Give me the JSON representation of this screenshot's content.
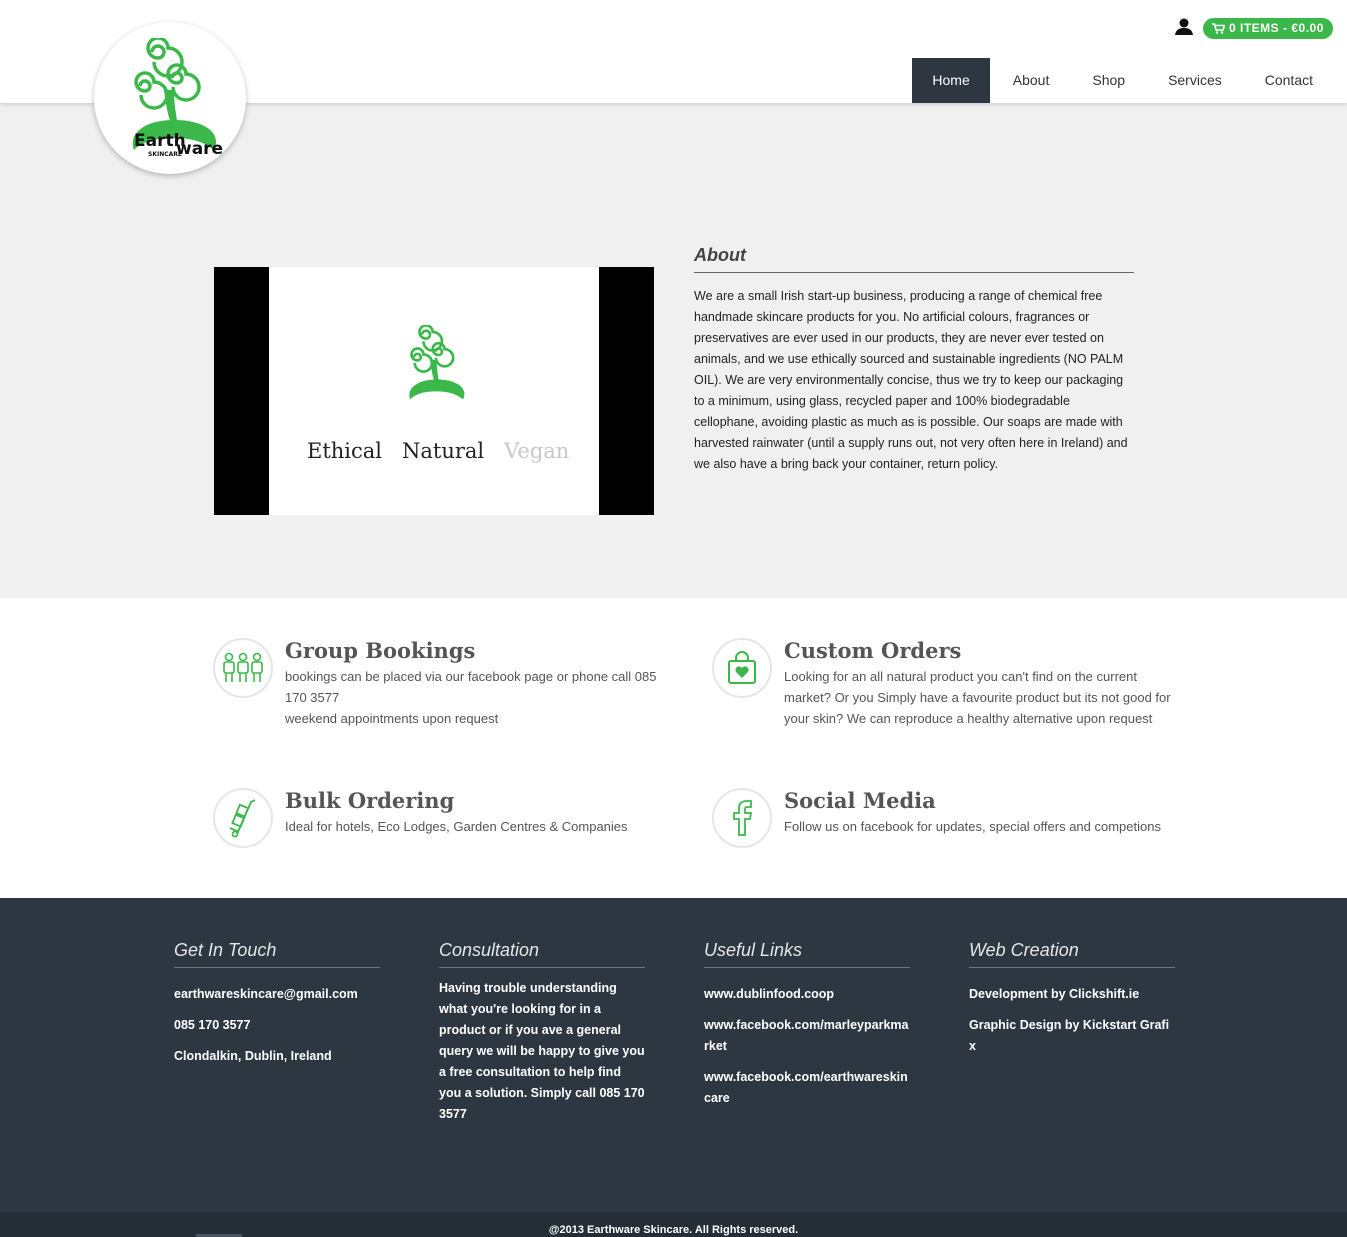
{
  "brand": {
    "name": "EarthWare Skincare",
    "logo_word1": "Earth",
    "logo_word2": "ware",
    "logo_sub": "SKINCARE",
    "accent": "#3cb84a"
  },
  "header": {
    "user_icon": "user-icon",
    "cart": {
      "icon": "cart-icon",
      "label": "0 ITEMS - €0.00"
    },
    "nav": [
      {
        "label": "Home",
        "active": true
      },
      {
        "label": "About",
        "active": false
      },
      {
        "label": "Shop",
        "active": false
      },
      {
        "label": "Services",
        "active": false
      },
      {
        "label": "Contact",
        "active": false
      }
    ]
  },
  "about": {
    "video": {
      "words": [
        "Ethical",
        "Natural",
        "Vegan"
      ]
    },
    "title": "About",
    "text": "We are a small Irish start-up business, producing a range of chemical free handmade skincare products for you. No artificial colours, fragrances or preservatives are ever used in our products, they are never ever tested on animals, and we use ethically sourced and sustainable ingredients (NO PALM OIL). We are very environmentally concise, thus we try to keep our packaging to a minimum, using glass, recycled paper and 100% biodegradable cellophane, avoiding plastic as much as is possible. Our soaps are made with harvested rainwater (until a supply runs out, not very often here in Ireland) and we also have a bring back your container, return policy."
  },
  "services": [
    {
      "icon": "group-icon",
      "title": "Group Bookings",
      "lines": [
        "bookings can be placed via our facebook page or phone call 085 170 3577",
        "weekend appointments upon request"
      ]
    },
    {
      "icon": "shopping-bag-heart-icon",
      "title": "Custom Orders",
      "lines": [
        "Looking for an all natural product you can't find on the current market? Or you Simply have a favourite product but its not good for your skin? We can reproduce a healthy alternative upon request"
      ]
    },
    {
      "icon": "hand-truck-icon",
      "title": "Bulk Ordering",
      "lines": [
        "Ideal for hotels, Eco Lodges, Garden Centres & Companies"
      ]
    },
    {
      "icon": "facebook-icon",
      "title": "Social Media",
      "lines": [
        "Follow us on facebook for updates, special offers and competions"
      ]
    }
  ],
  "footer": {
    "columns": [
      {
        "title": "Get In Touch",
        "items": [
          "earthwareskincare@gmail.com",
          "085 170 3577",
          "Clondalkin, Dublin, Ireland"
        ]
      },
      {
        "title": "Consultation",
        "text": "Having trouble understanding what you're looking for in a product or if you ave a general query we will be happy to give you a free consultation to help find you a solution. Simply call 085 170 3577"
      },
      {
        "title": "Useful Links",
        "items": [
          "www.dublinfood.coop",
          "www.facebook.com/marleyparkmarket",
          "www.facebook.com/earthwareskincare"
        ]
      },
      {
        "title": "Web Creation",
        "items": [
          "Development by Clickshift.ie",
          "Graphic Design by Kickstart Grafix"
        ]
      }
    ],
    "copyright": "@2013 Earthware Skincare. All Rights reserved."
  }
}
